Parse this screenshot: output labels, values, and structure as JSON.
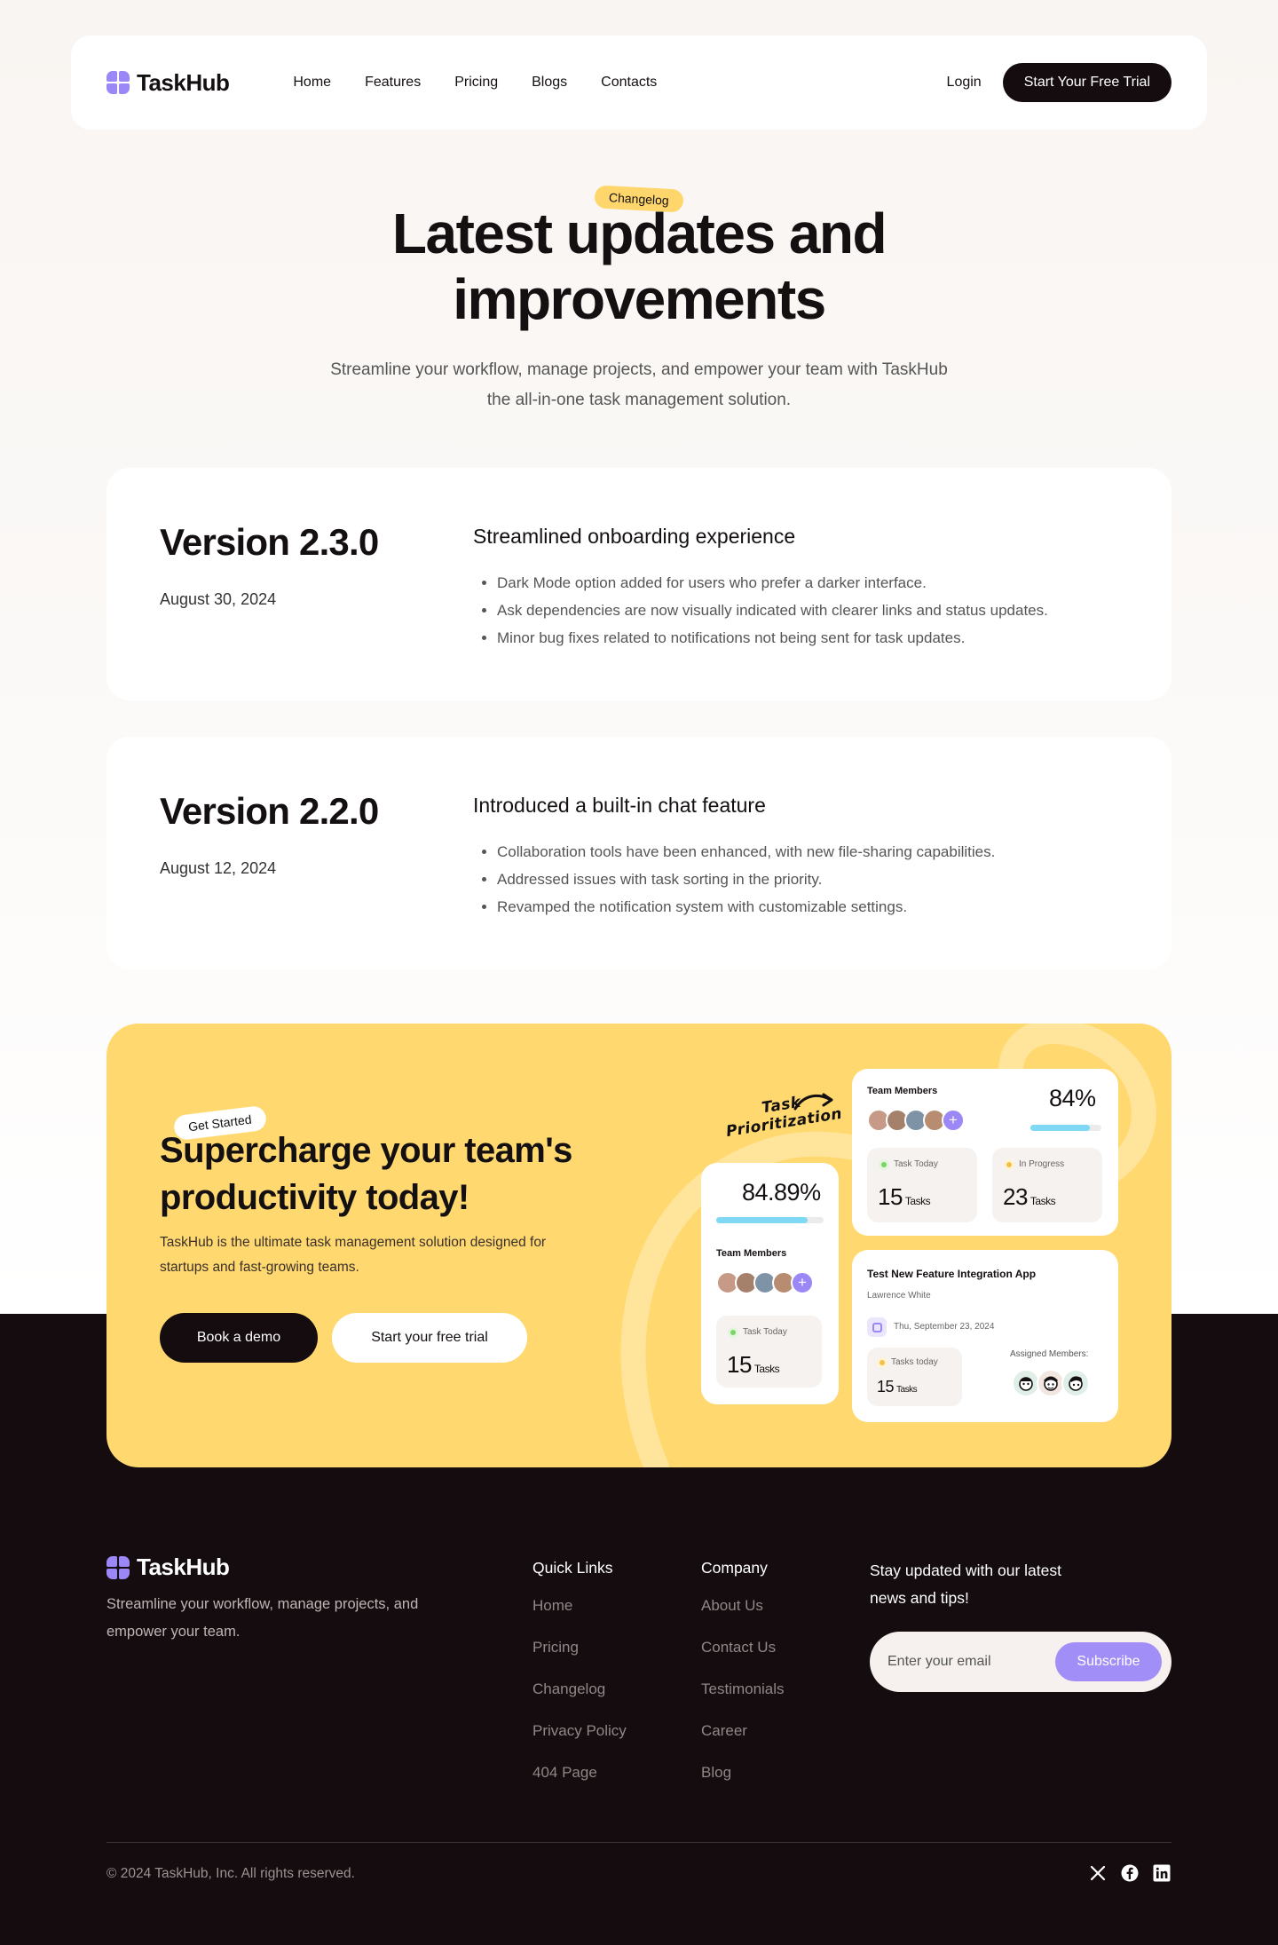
{
  "nav": {
    "logo": "TaskHub",
    "links": [
      "Home",
      "Features",
      "Pricing",
      "Blogs",
      "Contacts"
    ],
    "login": "Login",
    "cta": "Start Your Free Trial"
  },
  "hero": {
    "badge": "Changelog",
    "title": "Latest updates and improvements",
    "subtitle": "Streamline your workflow, manage projects, and empower your team with TaskHub the all-in-one task management solution."
  },
  "versions": [
    {
      "version": "Version 2.3.0",
      "date": "August 30, 2024",
      "heading": "Streamlined onboarding experience",
      "items": [
        "Dark Mode option added for users who prefer a darker interface.",
        "Ask dependencies are now visually indicated with clearer links and status updates.",
        "Minor bug fixes related to notifications not being sent for task updates."
      ]
    },
    {
      "version": "Version 2.2.0",
      "date": "August 12, 2024",
      "heading": "Introduced a built-in chat feature",
      "items": [
        "Collaboration tools have been enhanced, with new file-sharing capabilities.",
        "Addressed issues with task sorting in the priority.",
        "Revamped the notification system with customizable settings."
      ]
    }
  ],
  "cta": {
    "badge": "Get Started",
    "title": "Supercharge your team's productivity today!",
    "subtitle": "TaskHub is the ultimate task management solution designed for startups and fast-growing teams.",
    "primary": "Book a demo",
    "secondary": "Start your free trial",
    "note_line1": "Task",
    "note_line2": "Prioritization",
    "card_team": {
      "label": "Team Members",
      "percent": "84%",
      "progress": 0.84,
      "tile1_label": "Task Today",
      "tile1_value": "15",
      "tile1_unit": "Tasks",
      "tile2_label": "In Progress",
      "tile2_value": "23",
      "tile2_unit": "Tasks"
    },
    "card_small": {
      "percent": "84.89%",
      "progress": 0.8489,
      "label": "Team Members",
      "tile_label": "Task Today",
      "tile_value": "15",
      "tile_unit": "Tasks"
    },
    "card_task": {
      "title": "Test New Feature Integration App",
      "owner": "Lawrence White",
      "date": "Thu, September 23, 2024",
      "tile_label": "Tasks today",
      "tile_value": "15",
      "tile_unit": "Tasks",
      "assigned_label": "Assigned Members:"
    }
  },
  "footer": {
    "logo": "TaskHub",
    "description": "Streamline your workflow, manage projects, and empower your team.",
    "quick_links_title": "Quick Links",
    "quick_links": [
      "Home",
      "Pricing",
      "Changelog",
      "Privacy Policy",
      "404 Page"
    ],
    "company_title": "Company",
    "company_links": [
      "About Us",
      "Contact Us",
      "Testimonials",
      "Career",
      "Blog"
    ],
    "newsletter_text": "Stay updated with our latest news and tips!",
    "email_placeholder": "Enter your email",
    "subscribe": "Subscribe",
    "copyright": "© 2024 TaskHub, Inc. All rights reserved.",
    "socials": [
      "x-icon",
      "facebook-icon",
      "linkedin-icon"
    ]
  },
  "colors": {
    "accent": "#9b87f5",
    "yellow": "#ffd970",
    "dark": "#140c0e",
    "progress": "#7fd8f4"
  }
}
